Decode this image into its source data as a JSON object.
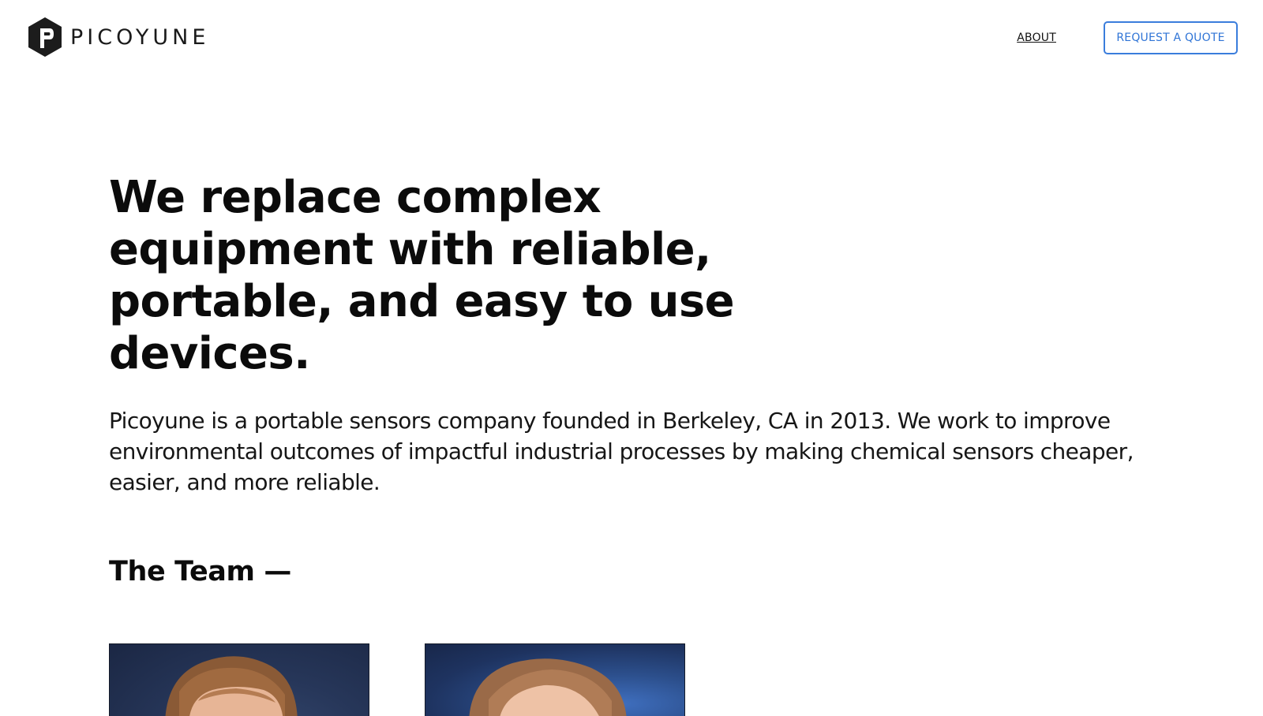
{
  "header": {
    "brand": "PICOYUNE",
    "logo_icon": "picoyune-hexagon-logo",
    "nav_about": "ABOUT",
    "quote_button": "REQUEST A QUOTE"
  },
  "hero": {
    "title": "We replace complex equipment with reliable, portable, and easy to use devices.",
    "body": "Picoyune is a portable sensors company founded in Berkeley, CA in 2013. We work to improve environmental outcomes of impactful industrial processes by making chemical sensors cheaper, easier, and more reliable."
  },
  "team": {
    "heading": "The Team —"
  },
  "colors": {
    "accent": "#3a7ddc",
    "text": "#111111",
    "background": "#ffffff",
    "photo_backdrop": "#27375a"
  }
}
